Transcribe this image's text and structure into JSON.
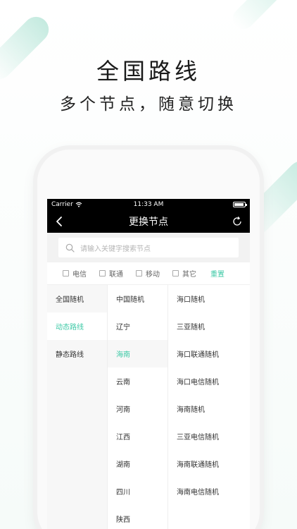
{
  "promo": {
    "headline": "全国路线",
    "subline": "多个节点，随意切换"
  },
  "status_bar": {
    "carrier": "Carrier",
    "time": "11:33 AM",
    "battery_level": 0.9
  },
  "nav": {
    "title": "更换节点",
    "back_icon": "chevron-left-icon",
    "refresh_icon": "refresh-icon"
  },
  "search": {
    "placeholder": "请输入关键字搜索节点"
  },
  "filters": {
    "options": [
      "电信",
      "联通",
      "移动",
      "其它"
    ],
    "reset_label": "重置"
  },
  "accent_color": "#3dc9a6",
  "columns": {
    "route_types": [
      "全国随机",
      "动态路线",
      "静态路线"
    ],
    "route_type_active": 1,
    "regions": [
      "中国随机",
      "辽宁",
      "海南",
      "云南",
      "河南",
      "江西",
      "湖南",
      "四川",
      "陕西"
    ],
    "region_active": 2,
    "nodes": [
      "海口随机",
      "三亚随机",
      "海口联通随机",
      "海口电信随机",
      "海南随机",
      "三亚电信随机",
      "海南联通随机",
      "海南电信随机"
    ]
  }
}
